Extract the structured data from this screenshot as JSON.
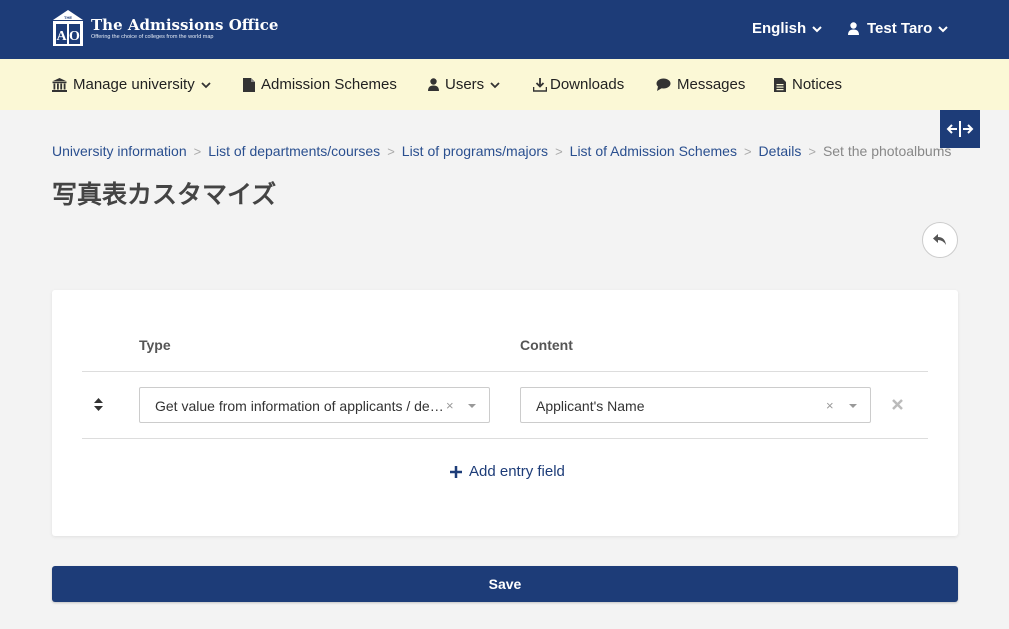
{
  "header": {
    "logo_title": "The Admissions Office",
    "logo_tagline": "Offering the choice of colleges from the world map",
    "logo_mark_top": "THE",
    "logo_mark_letters": "AO",
    "language": "English",
    "user_name": "Test Taro"
  },
  "nav": {
    "items": [
      {
        "label": "Manage university",
        "icon": "university-icon",
        "dropdown": true
      },
      {
        "label": "Admission Schemes",
        "icon": "file-icon",
        "dropdown": false
      },
      {
        "label": "Users",
        "icon": "user-icon",
        "dropdown": true
      },
      {
        "label": "Downloads",
        "icon": "download-icon",
        "dropdown": false
      },
      {
        "label": "Messages",
        "icon": "comment-icon",
        "dropdown": false
      },
      {
        "label": "Notices",
        "icon": "file-text-icon",
        "dropdown": false
      }
    ]
  },
  "breadcrumb": {
    "items": [
      "University information",
      "List of departments/courses",
      "List of programs/majors",
      "List of Admission Schemes",
      "Details"
    ],
    "current": "Set the photoalbums"
  },
  "page": {
    "title": "写真表カスタマイズ"
  },
  "form": {
    "columns": {
      "type": "Type",
      "content": "Content"
    },
    "rows": [
      {
        "type_value": "Get value from information of applicants / dec…",
        "content_value": "Applicant's Name"
      }
    ],
    "add_entry_label": "Add entry field",
    "save_label": "Save"
  },
  "colors": {
    "primary": "#1d3c78",
    "nav_bg": "#fbf8d6",
    "page_bg": "#f3f3f3"
  }
}
